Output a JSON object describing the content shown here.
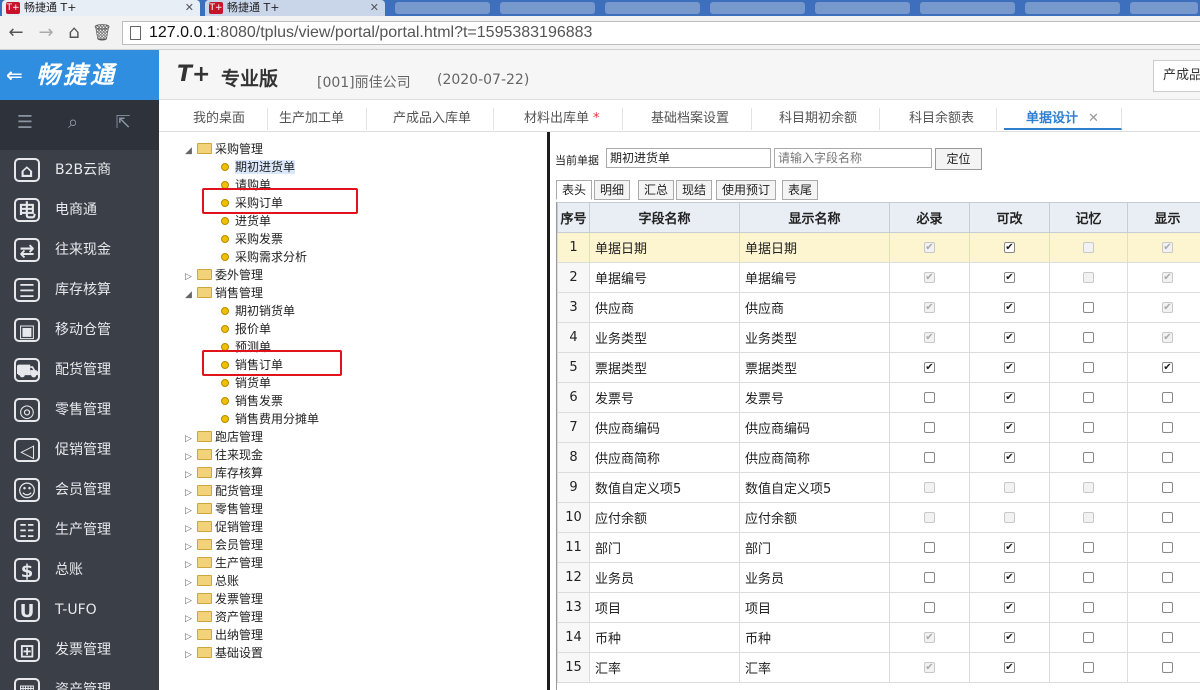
{
  "browser": {
    "tabs": [
      {
        "title": "畅捷通 T+",
        "icon": "T+"
      },
      {
        "title": "畅捷通 T+",
        "icon": "T+"
      }
    ],
    "url_host": "127.0.0.1",
    "url_rest": ":8080/tplus/view/portal/portal.html?t=1595383196883"
  },
  "sidebar": {
    "brand": "畅捷通",
    "items": [
      {
        "label": "B2B云商",
        "icon": "store-icon"
      },
      {
        "label": "电商通",
        "icon": "ecommerce-icon"
      },
      {
        "label": "往来现金",
        "icon": "exchange-icon"
      },
      {
        "label": "库存核算",
        "icon": "inventory-icon"
      },
      {
        "label": "移动仓管",
        "icon": "mobile-warehouse-icon"
      },
      {
        "label": "配货管理",
        "icon": "delivery-icon"
      },
      {
        "label": "零售管理",
        "icon": "retail-icon"
      },
      {
        "label": "促销管理",
        "icon": "promotion-icon"
      },
      {
        "label": "会员管理",
        "icon": "member-icon"
      },
      {
        "label": "生产管理",
        "icon": "production-icon"
      },
      {
        "label": "总账",
        "icon": "ledger-icon"
      },
      {
        "label": "T-UFO",
        "icon": "ufo-icon"
      },
      {
        "label": "发票管理",
        "icon": "invoice-icon"
      },
      {
        "label": "资产管理",
        "icon": "asset-icon"
      }
    ]
  },
  "header": {
    "product": "T+",
    "edition": "专业版",
    "company": "[001]丽佳公司",
    "date": "(2020-07-22)",
    "right_button": "产成品"
  },
  "function_tabs": [
    {
      "label": "我的桌面"
    },
    {
      "label": "生产加工单"
    },
    {
      "label": "产成品入库单"
    },
    {
      "label": "材料出库单",
      "modified": "*"
    },
    {
      "label": "基础档案设置"
    },
    {
      "label": "科目期初余额"
    },
    {
      "label": "科目余额表"
    },
    {
      "label": "单据设计",
      "close": "✕"
    }
  ],
  "tree": [
    {
      "label": "采购管理",
      "type": "folder",
      "expanded": true
    },
    {
      "label": "期初进货单",
      "type": "leaf",
      "selected": true
    },
    {
      "label": "请购单",
      "type": "leaf"
    },
    {
      "label": "采购订单",
      "type": "leaf"
    },
    {
      "label": "进货单",
      "type": "leaf"
    },
    {
      "label": "采购发票",
      "type": "leaf"
    },
    {
      "label": "采购需求分析",
      "type": "leaf"
    },
    {
      "label": "委外管理",
      "type": "folder",
      "expanded": false
    },
    {
      "label": "销售管理",
      "type": "folder",
      "expanded": true
    },
    {
      "label": "期初销货单",
      "type": "leaf"
    },
    {
      "label": "报价单",
      "type": "leaf"
    },
    {
      "label": "预测单",
      "type": "leaf"
    },
    {
      "label": "销售订单",
      "type": "leaf"
    },
    {
      "label": "销货单",
      "type": "leaf"
    },
    {
      "label": "销售发票",
      "type": "leaf"
    },
    {
      "label": "销售费用分摊单",
      "type": "leaf"
    },
    {
      "label": "跑店管理",
      "type": "folder",
      "expanded": false
    },
    {
      "label": "往来现金",
      "type": "folder",
      "expanded": false
    },
    {
      "label": "库存核算",
      "type": "folder",
      "expanded": false
    },
    {
      "label": "配货管理",
      "type": "folder",
      "expanded": false
    },
    {
      "label": "零售管理",
      "type": "folder",
      "expanded": false
    },
    {
      "label": "促销管理",
      "type": "folder",
      "expanded": false
    },
    {
      "label": "会员管理",
      "type": "folder",
      "expanded": false
    },
    {
      "label": "生产管理",
      "type": "folder",
      "expanded": false
    },
    {
      "label": "总账",
      "type": "folder",
      "expanded": false
    },
    {
      "label": "发票管理",
      "type": "folder",
      "expanded": false
    },
    {
      "label": "资产管理",
      "type": "folder",
      "expanded": false
    },
    {
      "label": "出纳管理",
      "type": "folder",
      "expanded": false
    },
    {
      "label": "基础设置",
      "type": "folder",
      "expanded": false
    }
  ],
  "design": {
    "current_label": "当前单据",
    "current_value": "期初进货单",
    "search_placeholder": "请输入字段名称",
    "locate_button": "定位",
    "sub_tabs": [
      "表头",
      "明细",
      "汇总",
      "现结",
      "使用预订",
      "表尾"
    ],
    "columns": [
      "序号",
      "字段名称",
      "显示名称",
      "必录",
      "可改",
      "记忆",
      "显示"
    ],
    "rows": [
      {
        "no": "1",
        "field": "单据日期",
        "display": "单据日期",
        "required": "on-dis",
        "editable": "on",
        "memory": "off-dis",
        "visible": "on-dis"
      },
      {
        "no": "2",
        "field": "单据编号",
        "display": "单据编号",
        "required": "on-dis",
        "editable": "on",
        "memory": "off-dis",
        "visible": "on-dis"
      },
      {
        "no": "3",
        "field": "供应商",
        "display": "供应商",
        "required": "on-dis",
        "editable": "on",
        "memory": "off",
        "visible": "on-dis"
      },
      {
        "no": "4",
        "field": "业务类型",
        "display": "业务类型",
        "required": "on-dis",
        "editable": "on",
        "memory": "off",
        "visible": "on-dis"
      },
      {
        "no": "5",
        "field": "票据类型",
        "display": "票据类型",
        "required": "on",
        "editable": "on",
        "memory": "off",
        "visible": "on"
      },
      {
        "no": "6",
        "field": "发票号",
        "display": "发票号",
        "required": "off",
        "editable": "on",
        "memory": "off",
        "visible": "off"
      },
      {
        "no": "7",
        "field": "供应商编码",
        "display": "供应商编码",
        "required": "off",
        "editable": "on",
        "memory": "off",
        "visible": "off"
      },
      {
        "no": "8",
        "field": "供应商简称",
        "display": "供应商简称",
        "required": "off",
        "editable": "on",
        "memory": "off",
        "visible": "off"
      },
      {
        "no": "9",
        "field": "数值自定义项5",
        "display": "数值自定义项5",
        "required": "off-dis",
        "editable": "off-dis",
        "memory": "off-dis",
        "visible": "off"
      },
      {
        "no": "10",
        "field": "应付余额",
        "display": "应付余额",
        "required": "off-dis",
        "editable": "off-dis",
        "memory": "off-dis",
        "visible": "off"
      },
      {
        "no": "11",
        "field": "部门",
        "display": "部门",
        "required": "off",
        "editable": "on",
        "memory": "off",
        "visible": "off"
      },
      {
        "no": "12",
        "field": "业务员",
        "display": "业务员",
        "required": "off",
        "editable": "on",
        "memory": "off",
        "visible": "off"
      },
      {
        "no": "13",
        "field": "项目",
        "display": "项目",
        "required": "off",
        "editable": "on",
        "memory": "off",
        "visible": "off"
      },
      {
        "no": "14",
        "field": "币种",
        "display": "币种",
        "required": "on-dis",
        "editable": "on",
        "memory": "off",
        "visible": "off"
      },
      {
        "no": "15",
        "field": "汇率",
        "display": "汇率",
        "required": "on-dis",
        "editable": "on",
        "memory": "off",
        "visible": "off"
      }
    ]
  }
}
